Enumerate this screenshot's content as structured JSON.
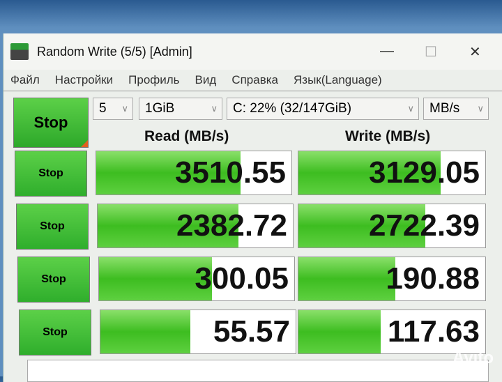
{
  "window": {
    "title": "Random Write (5/5) [Admin]",
    "minimize": "—",
    "maximize": "☐",
    "close": "✕"
  },
  "menu": [
    "Файл",
    "Настройки",
    "Профиль",
    "Вид",
    "Справка",
    "Язык(Language)"
  ],
  "controls": {
    "all_button": "Stop",
    "count": "5",
    "size": "1GiB",
    "drive": "C: 22% (32/147GiB)",
    "unit": "MB/s"
  },
  "headers": {
    "read": "Read (MB/s)",
    "write": "Write (MB/s)"
  },
  "rows": [
    {
      "button": "Stop",
      "read": "3510.55",
      "write": "3129.05",
      "read_fill": 0.74,
      "write_fill": 0.76
    },
    {
      "button": "Stop",
      "read": "2382.72",
      "write": "2722.39",
      "read_fill": 0.72,
      "write_fill": 0.68
    },
    {
      "button": "Stop",
      "read": "300.05",
      "write": "190.88",
      "read_fill": 0.58,
      "write_fill": 0.52
    },
    {
      "button": "Stop",
      "read": "55.57",
      "write": "117.63",
      "read_fill": 0.46,
      "write_fill": 0.44
    }
  ],
  "watermark": "Avito",
  "colors": {
    "accent": "#3dbd20"
  }
}
